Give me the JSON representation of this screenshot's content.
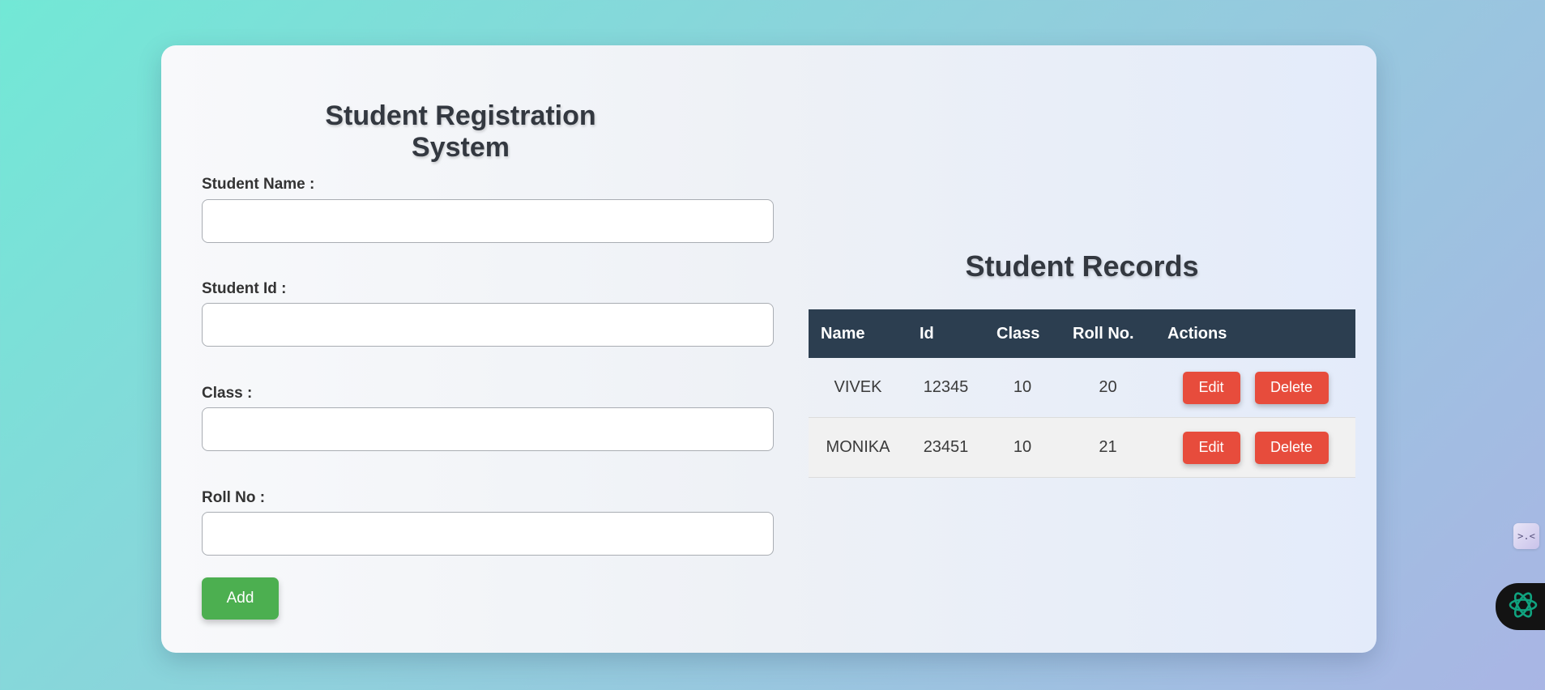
{
  "form": {
    "title": "Student Registration System",
    "fields": [
      {
        "label": "Student Name :",
        "value": "",
        "placeholder": ""
      },
      {
        "label": "Student Id :",
        "value": "",
        "placeholder": ""
      },
      {
        "label": "Class :",
        "value": "",
        "placeholder": ""
      },
      {
        "label": "Roll No :",
        "value": "",
        "placeholder": ""
      }
    ],
    "add_label": "Add"
  },
  "records": {
    "title": "Student Records",
    "columns": [
      "Name",
      "Id",
      "Class",
      "Roll No.",
      "Actions"
    ],
    "rows": [
      {
        "name": "VIVEK",
        "id": "12345",
        "class": "10",
        "roll": "20"
      },
      {
        "name": "MONIKA",
        "id": "23451",
        "class": "10",
        "roll": "21"
      }
    ],
    "edit_label": "Edit",
    "delete_label": "Delete"
  },
  "widgets": {
    "side_widget_glyph": ">.<",
    "side_widget_icon": "extension-icon",
    "assistant_icon": "assistant-logo-icon"
  },
  "colors": {
    "add_button": "#4caf50",
    "danger_button": "#e74c3c",
    "table_header": "#2c3e50",
    "assistant_icon": "#10a37f"
  }
}
